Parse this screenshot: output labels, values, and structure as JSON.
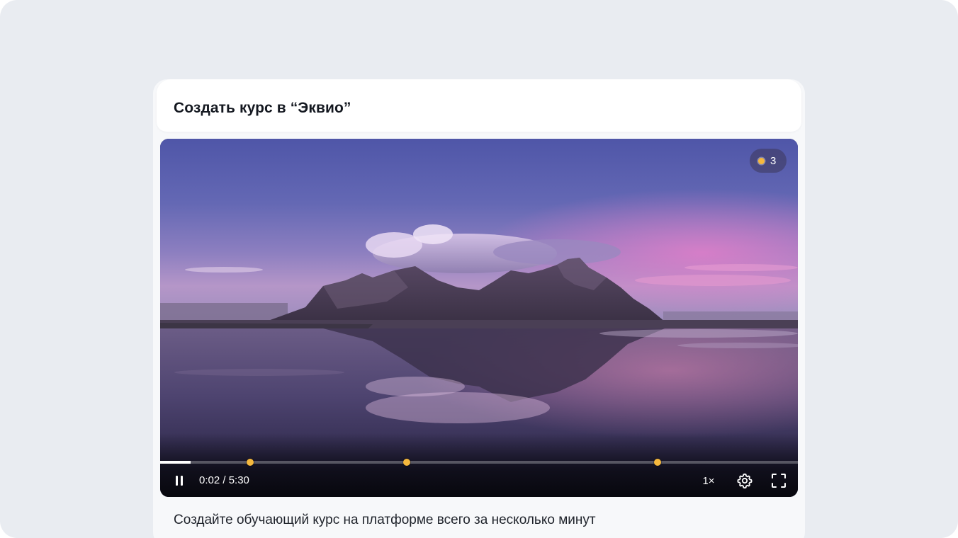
{
  "card": {
    "title": "Создать курс в “Эквио”",
    "description": "Создайте обучающий курс на платформе всего за несколько минут"
  },
  "player": {
    "badge": {
      "icon": "marker-dot-icon",
      "count": "3"
    },
    "progress": {
      "played_fraction": 0.048,
      "marker_fractions": [
        0.141,
        0.387,
        0.78
      ],
      "marker_color": "#f5b83d"
    },
    "controls": {
      "play_state_icon": "pause-icon",
      "time": "0:02 / 5:30",
      "speed": "1×",
      "settings_icon": "gear-icon",
      "fullscreen_icon": "fullscreen-icon"
    }
  }
}
